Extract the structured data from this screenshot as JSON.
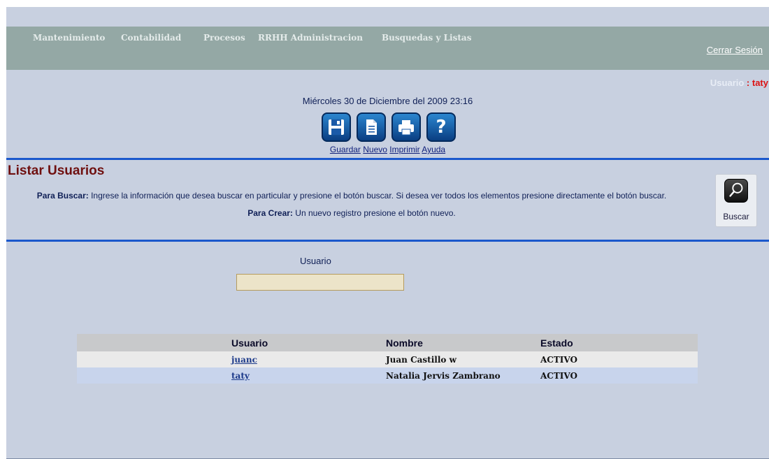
{
  "menu": {
    "items": [
      {
        "label": "Mantenimiento"
      },
      {
        "label": "Contabilidad"
      },
      {
        "label": "Procesos"
      },
      {
        "label": "RRHH Administracion"
      },
      {
        "label": "Busquedas y Listas"
      }
    ],
    "logout_label": "Cerrar Sesión"
  },
  "user": {
    "label": "Usuario",
    "separator": " : ",
    "name": "taty"
  },
  "date": "Miércoles 30 de Diciembre del 2009 23:16",
  "toolbar": {
    "buttons": [
      {
        "label": "Guardar",
        "icon": "save-icon"
      },
      {
        "label": "Nuevo",
        "icon": "new-document-icon"
      },
      {
        "label": "Imprimir",
        "icon": "print-icon"
      },
      {
        "label": "Ayuda",
        "icon": "help-icon",
        "glyph": "?"
      }
    ]
  },
  "page": {
    "title": "Listar Usuarios",
    "search_help_label": "Para Buscar:",
    "search_help_text": " Ingrese la información que desea buscar en particular y presione el botón buscar. Si desea ver todos los elementos presione directamente el botón buscar.",
    "create_help_label": "Para Crear:",
    "create_help_text": " Un nuevo registro presione el botón nuevo."
  },
  "search": {
    "button_label": "Buscar",
    "icon": "magnifier-icon",
    "field_label": "Usuario",
    "value": ""
  },
  "table": {
    "columns": [
      "Usuario",
      "Nombre",
      "Estado"
    ],
    "rows": [
      {
        "usuario": "juanc",
        "nombre": "Juan Castillo w",
        "estado": "ACTIVO"
      },
      {
        "usuario": "taty",
        "nombre": "Natalia Jervis Zambrano",
        "estado": "ACTIVO"
      }
    ]
  },
  "colors": {
    "background": "#c8d0e0",
    "menubar": "#94a8a5",
    "accent_line": "#1b58cc",
    "title": "#6f1010",
    "user_name": "#dd1111"
  }
}
